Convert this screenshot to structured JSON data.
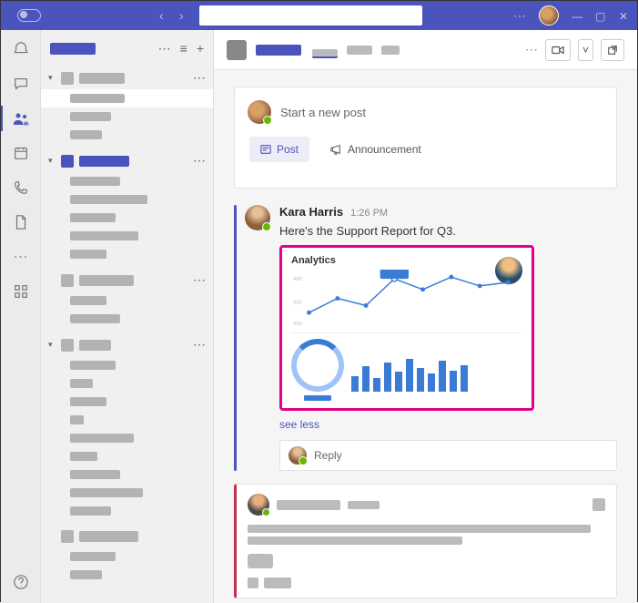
{
  "titlebar": {
    "back": "‹",
    "forward": "›",
    "more": "⋯",
    "minimize": "—",
    "maximize": "▢",
    "close": "✕"
  },
  "rail": {
    "items": [
      "activity",
      "chat",
      "teams",
      "calendar",
      "calls",
      "files"
    ],
    "more": "apps",
    "help": "help"
  },
  "sidebar": {
    "title_redacted": true,
    "header_actions": {
      "more": "⋯",
      "filter": "≡",
      "add": "+"
    }
  },
  "channel_header": {
    "more": "⋯",
    "meet_icon": "video",
    "popout_icon": "popout"
  },
  "compose": {
    "placeholder": "Start a new post",
    "post_label": "Post",
    "announce_label": "Announcement"
  },
  "post1": {
    "author": "Kara Harris",
    "time": "1:26 PM",
    "text": "Here's the Support Report for Q3.",
    "attachment_title": "Analytics",
    "see_less": "see less",
    "reply": "Reply"
  },
  "chart_data": {
    "type": "line",
    "title": "Analytics",
    "x": [
      1,
      2,
      3,
      4,
      5,
      6,
      7,
      8
    ],
    "values": [
      280,
      330,
      300,
      420,
      380,
      430,
      400,
      410
    ],
    "ylim": [
      200,
      450
    ],
    "bar_series": {
      "type": "bar",
      "values": [
        30,
        48,
        26,
        55,
        38,
        62,
        45,
        34,
        58,
        40,
        50
      ]
    }
  }
}
